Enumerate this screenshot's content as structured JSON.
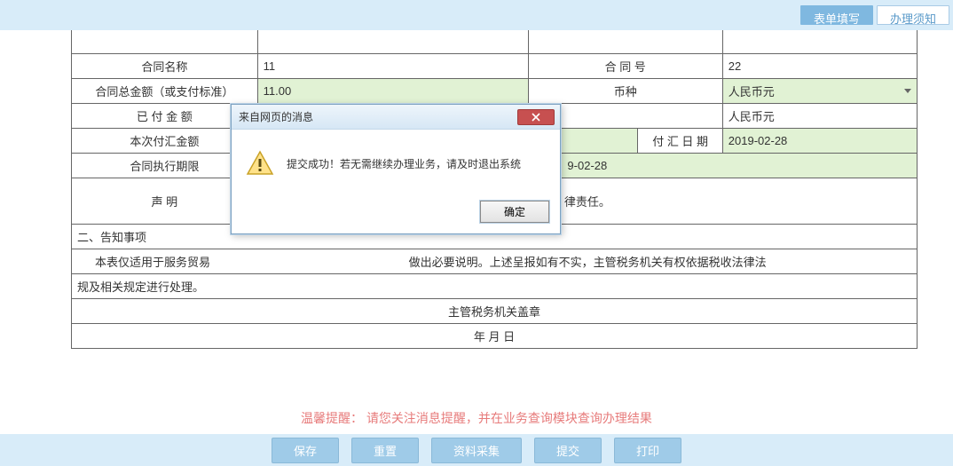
{
  "tabs": {
    "form_fill": "表单填写",
    "guide": "办理须知"
  },
  "labels": {
    "contract_name": "合同名称",
    "contract_no": "合 同 号",
    "total_amount": "合同总金额（或支付标准）",
    "currency": "币种",
    "paid_amount": "已 付 金 额",
    "this_remit": "本次付汇金额",
    "remit_date": "付 汇 日 期",
    "exec_period": "合同执行期限",
    "declaration": "声  明"
  },
  "values": {
    "contract_name": "11",
    "contract_no": "22",
    "total_amount": "11.00",
    "currency1": "人民币元",
    "currency2": "人民币元",
    "remit_date": "2019-02-28",
    "exec_partial": "9-02-28",
    "decl_partial": "律责任。"
  },
  "section2": {
    "title": "二、告知事项",
    "line1_left": "本表仅适用于服务贸易",
    "line1_right": "做出必要说明。上述呈报如有不实，主管税务机关有权依据税收法律法",
    "line2": "规及相关规定进行处理。"
  },
  "seal": {
    "org": "主管税务机关盖章",
    "date": "年  月  日"
  },
  "reminder": {
    "label": "温馨提醒：",
    "text": "请您关注消息提醒，并在业务查询模块查询办理结果"
  },
  "buttons": {
    "save": "保存",
    "reset": "重置",
    "collect": "资料采集",
    "submit": "提交",
    "print": "打印"
  },
  "modal": {
    "title": "来自网页的消息",
    "message": "提交成功！若无需继续办理业务，请及时退出系统",
    "ok": "确定"
  }
}
